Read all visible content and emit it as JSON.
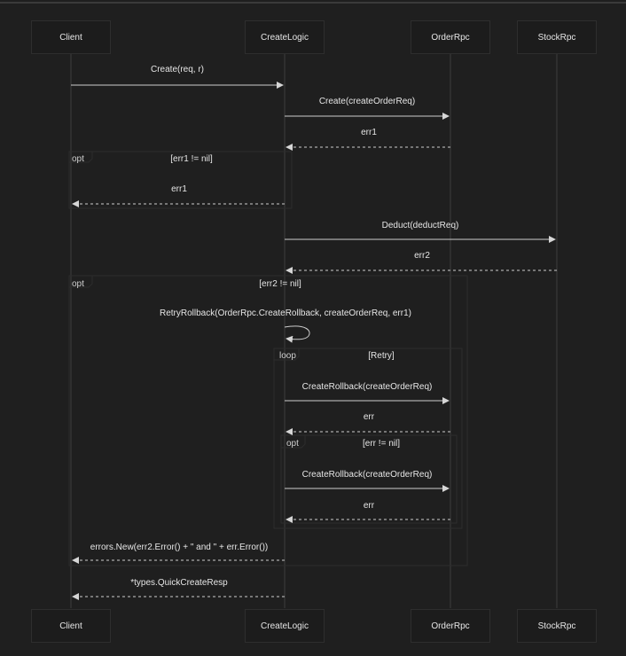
{
  "participants": [
    "Client",
    "CreateLogic",
    "OrderRpc",
    "StockRpc"
  ],
  "messages": [
    {
      "label": "Create(req, r)"
    },
    {
      "label": "Create(createOrderReq)"
    },
    {
      "label": "err1"
    },
    {
      "label": "err1"
    },
    {
      "label": "Deduct(deductReq)"
    },
    {
      "label": "err2"
    },
    {
      "label": "RetryRollback(OrderRpc.CreateRollback, createOrderReq, err1)"
    },
    {
      "label": "CreateRollback(createOrderReq)"
    },
    {
      "label": "err"
    },
    {
      "label": "CreateRollback(createOrderReq)"
    },
    {
      "label": "err"
    },
    {
      "label": "errors.New(err2.Error() + \" and \" + err.Error())"
    },
    {
      "label": "*types.QuickCreateResp"
    }
  ],
  "fragments": [
    {
      "keyword": "opt",
      "condition": "[err1 != nil]"
    },
    {
      "keyword": "opt",
      "condition": "[err2 != nil]"
    },
    {
      "keyword": "loop",
      "condition": "[Retry]"
    },
    {
      "keyword": "opt",
      "condition": "[err != nil]"
    }
  ],
  "colors": {
    "background": "#1f1f1f",
    "line": "#cccccc",
    "lifeline": "#3c3c3c",
    "box_border": "#2e2e2e",
    "text": "#e6e6e6"
  }
}
